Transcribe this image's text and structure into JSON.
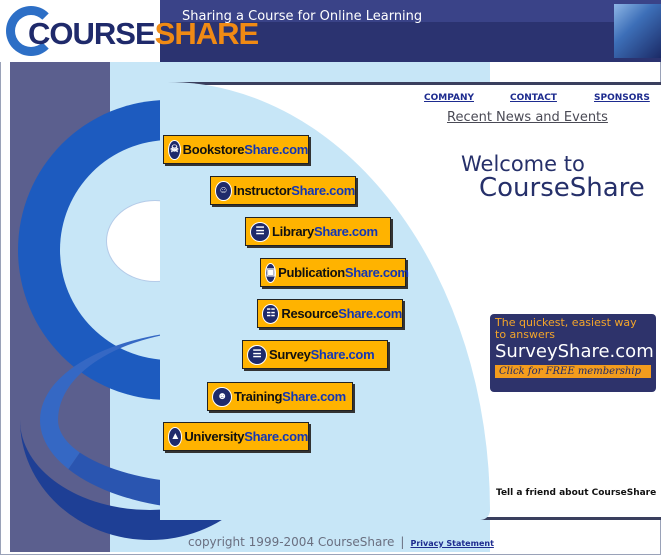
{
  "header": {
    "logo_part1": "COURSE",
    "logo_part2": "SHARE",
    "tagline": "Sharing a Course for Online Learning"
  },
  "nav": {
    "company": "COMPANY",
    "contact": "CONTACT",
    "sponsors": "SPONSORS"
  },
  "news_link": "Recent News and Events",
  "welcome": {
    "line1": "Welcome to",
    "line2": "CourseShare"
  },
  "sites": [
    {
      "prefix": "Bookstore",
      "suffix": "Share.com",
      "icon": "bookstore-icon"
    },
    {
      "prefix": "Instructor",
      "suffix": "Share.com",
      "icon": "instructor-icon"
    },
    {
      "prefix": "Library",
      "suffix": "Share.com",
      "icon": "library-icon"
    },
    {
      "prefix": "Publication",
      "suffix": "Share.com",
      "icon": "publication-icon"
    },
    {
      "prefix": "Resource",
      "suffix": "Share.com",
      "icon": "resource-icon"
    },
    {
      "prefix": "Survey",
      "suffix": "Share.com",
      "icon": "survey-icon"
    },
    {
      "prefix": "Training",
      "suffix": "Share.com",
      "icon": "training-icon"
    },
    {
      "prefix": "University",
      "suffix": "Share.com",
      "icon": "university-icon"
    }
  ],
  "ad": {
    "line1": "The quickest, easiest way",
    "line2": "to answers",
    "brand": "SurveyShare.com",
    "cta": "Click for FREE membership"
  },
  "tell_friend": "Tell a friend about CourseShare",
  "footer": {
    "copyright": "copyright 1999-2004 CourseShare",
    "separator": "|",
    "privacy": "Privacy Statement"
  },
  "colors": {
    "brand_navy": "#2b3370",
    "brand_orange": "#f08a14",
    "button_yellow": "#ffb300",
    "link_blue": "#1d2b8f"
  }
}
